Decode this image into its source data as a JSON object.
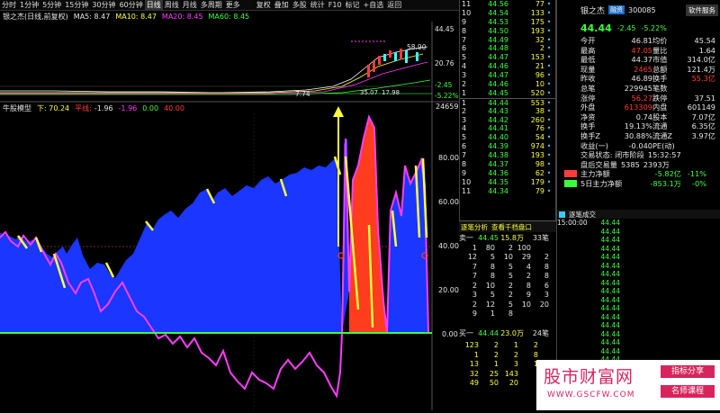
{
  "toolbar": {
    "items": [
      "分时",
      "1分钟",
      "5分钟",
      "15分钟",
      "30分钟",
      "60分钟",
      "日线",
      "周线",
      "月线",
      "多周期",
      "更多"
    ],
    "active_index": 6,
    "right_items": [
      "复权",
      "叠加",
      "多股",
      "统计",
      "F10",
      "标记",
      "+自选",
      "返回"
    ]
  },
  "title": {
    "stock": "银之杰(日线,前复权)",
    "ma5": "MA5: 8.47",
    "ma10": "MA10: 8.47",
    "ma20": "MA20: 8.45",
    "ma60": "MA60: 8.45"
  },
  "main_chart": {
    "price_labels": [
      "44.45",
      "20.76",
      "-2.45",
      "-5.22%"
    ],
    "annotations": [
      "58.90",
      "7.74",
      "35.07",
      "17.98"
    ],
    "volume_label": "24659"
  },
  "indicator": {
    "name": "牛股模型",
    "lower_label": "下: 70.24",
    "flat_label": "平线:",
    "v1": "-1.96",
    "v2": "-1.96",
    "v3": "0.00",
    "v4": "40.00",
    "axis": [
      "80.00",
      "60.00",
      "40.00",
      "20.00",
      "0.00"
    ]
  },
  "ticks": [
    {
      "n": "11",
      "p": "44.56",
      "v": "77"
    },
    {
      "n": "10",
      "p": "44.54",
      "v": "133"
    },
    {
      "n": "9",
      "p": "44.53",
      "v": "175"
    },
    {
      "n": "8",
      "p": "44.50",
      "v": "193"
    },
    {
      "n": "7",
      "p": "44.49",
      "v": "32"
    },
    {
      "n": "6",
      "p": "44.48",
      "v": "2"
    },
    {
      "n": "5",
      "p": "44.47",
      "v": "153"
    },
    {
      "n": "4",
      "p": "44.46",
      "v": "21"
    },
    {
      "n": "3",
      "p": "44.47",
      "v": "96"
    },
    {
      "n": "2",
      "p": "44.46",
      "v": "10"
    },
    {
      "n": "1",
      "p": "44.45",
      "v": "520"
    },
    {
      "n": "1",
      "p": "44.44",
      "v": "553"
    },
    {
      "n": "2",
      "p": "44.43",
      "v": "38"
    },
    {
      "n": "3",
      "p": "44.42",
      "v": "260"
    },
    {
      "n": "4",
      "p": "44.41",
      "v": "76"
    },
    {
      "n": "5",
      "p": "44.40",
      "v": "54"
    },
    {
      "n": "6",
      "p": "44.39",
      "v": "974"
    },
    {
      "n": "7",
      "p": "44.38",
      "v": "193"
    },
    {
      "n": "8",
      "p": "44.37",
      "v": "98"
    },
    {
      "n": "9",
      "p": "44.36",
      "v": "62"
    },
    {
      "n": "10",
      "p": "44.35",
      "v": "179"
    },
    {
      "n": "11",
      "p": "44.34",
      "v": "79"
    }
  ],
  "info": {
    "name": "银之杰",
    "tag": "融资",
    "code": "300085",
    "service": "软件服务",
    "price": "44.44",
    "change": "-2.45",
    "pct": "-5.22%",
    "rows": [
      {
        "l1": "今开",
        "v1": "46.81",
        "l2": "均价",
        "v2": "45.54"
      },
      {
        "l1": "最高",
        "v1": "47.05",
        "l2": "量比",
        "v2": "1.64"
      },
      {
        "l1": "最低",
        "v1": "44.37",
        "l2": "市值",
        "v2": "314.0亿"
      },
      {
        "l1": "现量",
        "v1": "2465",
        "l2": "总额",
        "v2": "121.4万"
      },
      {
        "l1": "昨收",
        "v1": "46.89",
        "l2": "换手",
        "v2": "55.3亿"
      },
      {
        "l1": "总笔",
        "v1": "229945",
        "l2": "笔数",
        "v2": ""
      },
      {
        "l1": "涨停",
        "v1": "56.27",
        "l2": "跌停",
        "v2": "37.51"
      },
      {
        "l1": "外盘",
        "v1": "613309",
        "l2": "内盘",
        "v2": "601149"
      },
      {
        "l1": "净资",
        "v1": "0.74",
        "l2": "股本",
        "v2": "7.07亿"
      },
      {
        "l1": "换手",
        "v1": "19.13%",
        "l2": "流通",
        "v2": "6.35亿"
      },
      {
        "l1": "换手Z",
        "v1": "30.88%",
        "l2": "流通Z",
        "v2": "3.97亿"
      },
      {
        "l1": "收益(一)",
        "v1": "-0.040",
        "l2": "PE(动)",
        "v2": ""
      }
    ],
    "trade_status": "交易状态: 闭市阶段",
    "trade_time": "15:32:57",
    "after_label": "盘后交易量",
    "after_vol": "5385",
    "after_amt": "2393万",
    "main_net_label": "主力净额",
    "main_net": "-5.82亿",
    "main_net_pct": "-11%",
    "five_label": "5日主力净额",
    "five_val": "-853.1万",
    "five_pct": "-0%"
  },
  "orderbox": {
    "tabs": [
      "逐笔分析",
      "查看千档盘口"
    ],
    "sell_label": "卖一",
    "sell_price": "44.45",
    "sell_vol": "15.8万",
    "sell_count": "33笔",
    "sell_rows": [
      [
        "1",
        "80",
        "2",
        "100"
      ],
      [
        "12",
        "5",
        "10",
        "29",
        "2"
      ],
      [
        "7",
        "8",
        "5",
        "4",
        "8"
      ],
      [
        "7",
        "8",
        "5",
        "2",
        "8"
      ],
      [
        "2",
        "10",
        "2",
        "8",
        "6"
      ],
      [
        "3",
        "5",
        "2",
        "9",
        "3"
      ],
      [
        "2",
        "12",
        "5",
        "10",
        "20"
      ],
      [
        "9",
        "1",
        "8",
        ""
      ]
    ],
    "buy_label": "买一",
    "buy_price": "44.44",
    "buy_vol": "23.0万",
    "buy_count": "24笔",
    "buy_rows": [
      [
        "123",
        "2",
        "1",
        "2"
      ],
      [
        "1",
        "2",
        "2",
        "8"
      ],
      [
        "13",
        "1",
        "3",
        "1"
      ],
      [
        "32",
        "25",
        "143"
      ],
      [
        "49",
        "50",
        "20"
      ]
    ]
  },
  "deals": {
    "title": "逐笔成交",
    "first_time": "15:00:00",
    "price": "44.44",
    "rows": 20
  },
  "ad": {
    "brand": "股市财富网",
    "url": "WWW.GSCFW.COM",
    "tag1": "指标分享",
    "tag2": "名师课程"
  },
  "chart_data": {
    "type": "area",
    "ylim": [
      0,
      100
    ],
    "axis_ticks": [
      80,
      60,
      40,
      20,
      0
    ]
  }
}
